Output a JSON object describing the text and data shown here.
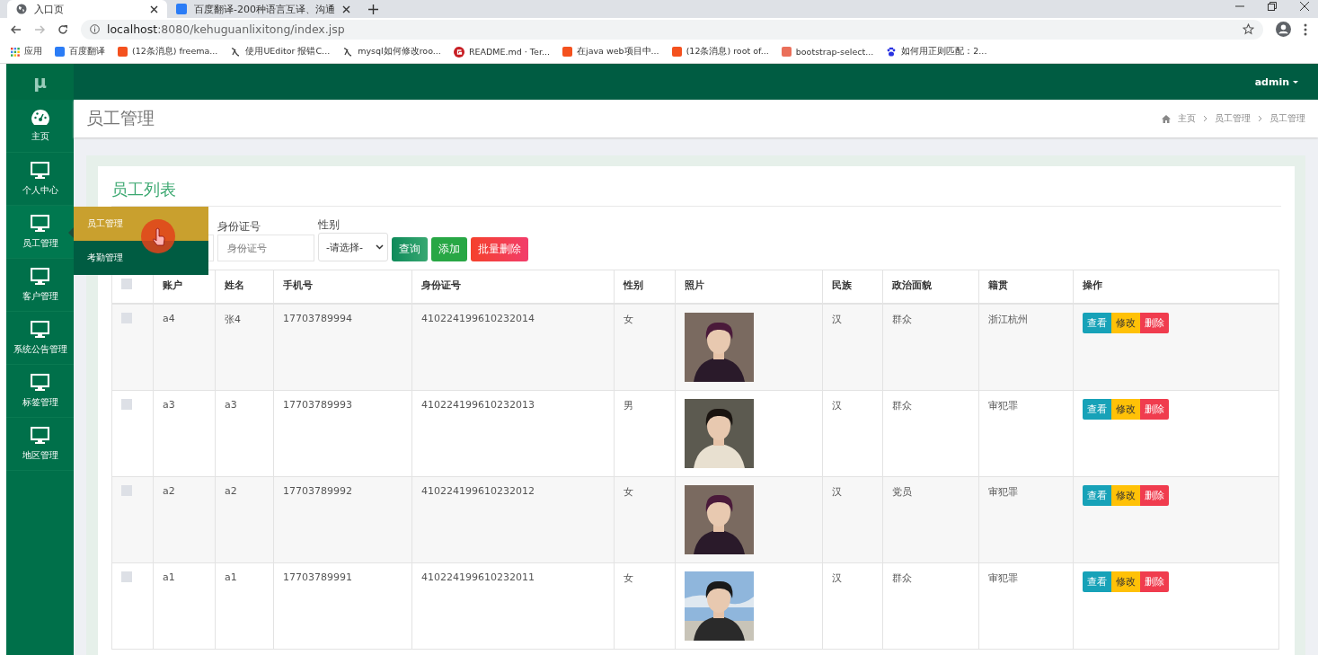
{
  "browser": {
    "tabs": [
      {
        "title": "入口页",
        "kind": "globe",
        "selected": true
      },
      {
        "title": "百度翻译-200种语言互译、沟通",
        "kind": "translate",
        "selected": false
      }
    ],
    "url_host": "localhost",
    "url_rest": ":8080/kehuguanlixitong/index.jsp",
    "bookmarks": [
      {
        "label": "应用",
        "kind": "apps"
      },
      {
        "label": "百度翻译",
        "kind": "translate"
      },
      {
        "label": "(12条消息) freema...",
        "kind": "csdn"
      },
      {
        "label": "使用UEditor 报错C...",
        "kind": "script"
      },
      {
        "label": "mysql如何修改roo...",
        "kind": "script"
      },
      {
        "label": "README.md · Ter...",
        "kind": "gitee"
      },
      {
        "label": "在java web项目中...",
        "kind": "csdn"
      },
      {
        "label": "(12条消息) root of...",
        "kind": "csdn"
      },
      {
        "label": "bootstrap-select...",
        "kind": "jianshu"
      },
      {
        "label": "如何用正则匹配：2...",
        "kind": "paw"
      }
    ]
  },
  "app": {
    "logo": "μ",
    "user": "admin",
    "sidebar": [
      {
        "label": "主页",
        "kind": "dashboard",
        "selected": false
      },
      {
        "label": "个人中心",
        "kind": "monitor",
        "selected": false
      },
      {
        "label": "员工管理",
        "kind": "monitor",
        "selected": true
      },
      {
        "label": "客户管理",
        "kind": "monitor",
        "selected": false
      },
      {
        "label": "系统公告管理",
        "kind": "monitor",
        "selected": false
      },
      {
        "label": "标签管理",
        "kind": "monitor",
        "selected": false
      },
      {
        "label": "地区管理",
        "kind": "monitor",
        "selected": false
      }
    ],
    "submenu": [
      {
        "label": "员工管理",
        "selected": true
      },
      {
        "label": "考勤管理",
        "selected": false
      }
    ],
    "page_title": "员工管理",
    "breadcrumb": [
      "主页",
      "员工管理",
      "员工管理"
    ],
    "card_title": "员工列表",
    "filters": [
      {
        "label": "身份证号",
        "kind": "text",
        "placeholder": "身份证号"
      },
      {
        "label": "性别",
        "kind": "select",
        "value": "-请选择-"
      }
    ],
    "buttons": [
      {
        "label": "查询",
        "kind": "search"
      },
      {
        "label": "添加",
        "kind": "add"
      },
      {
        "label": "批量删除",
        "kind": "delete"
      }
    ],
    "table": {
      "columns": [
        "账户",
        "姓名",
        "手机号",
        "身份证号",
        "性别",
        "照片",
        "民族",
        "政治面貌",
        "籍贯",
        "操作"
      ],
      "select_all_checked": false,
      "rows": [
        {
          "checked": false,
          "cells": [
            "a4",
            "张4",
            "17703789994",
            "410224199610232014",
            "女",
            {
              "kind": "picture"
            },
            "汉",
            "群众",
            "浙江杭州"
          ],
          "actions": [
            "查看",
            "修改",
            "删除"
          ]
        },
        {
          "checked": false,
          "cells": [
            "a3",
            "a3",
            "17703789993",
            "410224199610232013",
            "男",
            {
              "kind": "picture"
            },
            "汉",
            "群众",
            "审犯罪"
          ],
          "actions": [
            "查看",
            "修改",
            "删除"
          ]
        },
        {
          "checked": false,
          "cells": [
            "a2",
            "a2",
            "17703789992",
            "410224199610232012",
            "女",
            {
              "kind": "picture"
            },
            "汉",
            "党员",
            "审犯罪"
          ],
          "actions": [
            "查看",
            "修改",
            "删除"
          ]
        },
        {
          "checked": false,
          "cells": [
            "a1",
            "a1",
            "17703789991",
            "410224199610232011",
            "女",
            {
              "kind": "picture"
            },
            "汉",
            "群众",
            "审犯罪"
          ],
          "actions": [
            "查看",
            "修改",
            "删除"
          ]
        }
      ]
    }
  }
}
